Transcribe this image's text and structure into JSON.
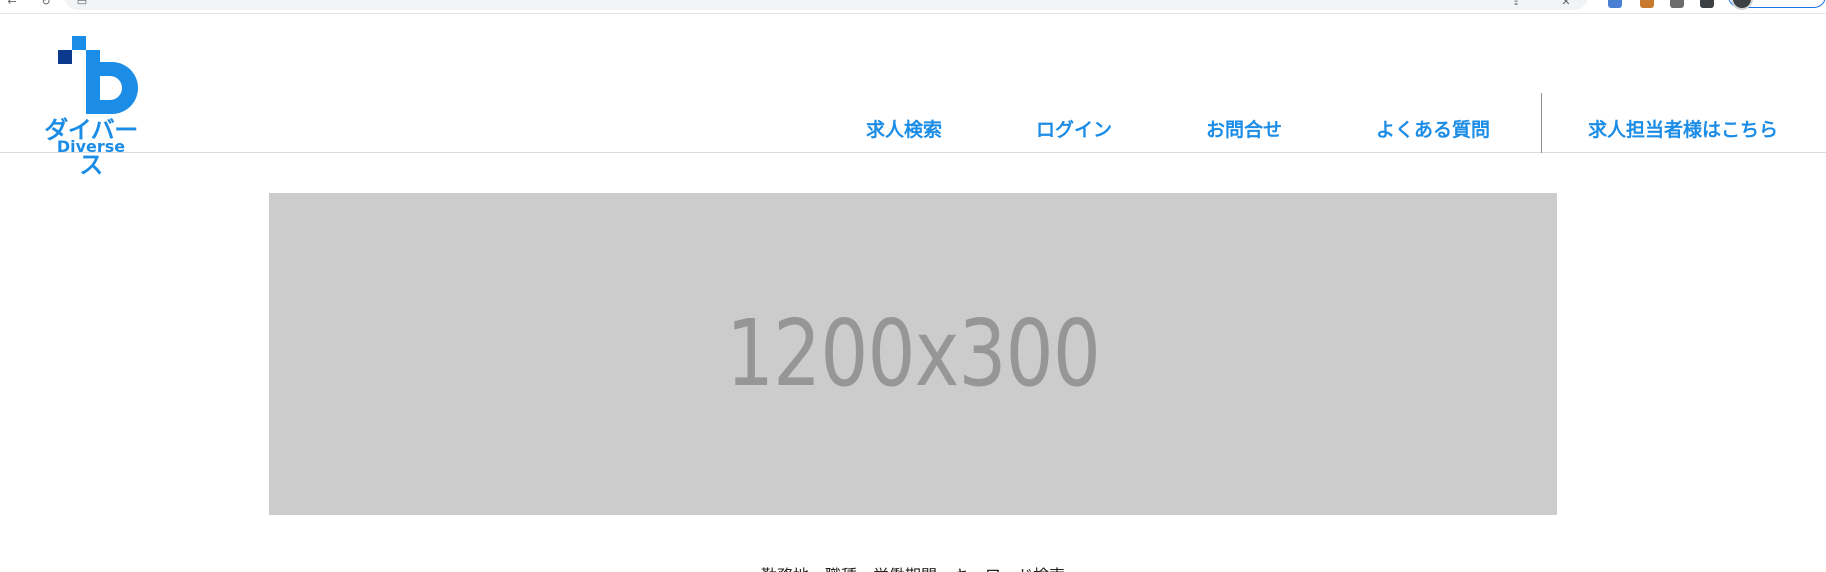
{
  "browser": {
    "icons": [
      "back-icon",
      "reload-icon",
      "site-info-icon",
      "share-icon",
      "bookmark-star-icon",
      "extension-icon",
      "profile-avatar-icon"
    ]
  },
  "header": {
    "logo": {
      "name_jp": "ダイバース",
      "name_en": "Diverse",
      "brand_color": "#1c8de6",
      "dark_color": "#0b3a8c"
    },
    "nav": [
      {
        "label": "求人検索"
      },
      {
        "label": "ログイン"
      },
      {
        "label": "お問合せ"
      },
      {
        "label": "よくある質問"
      },
      {
        "label": "求人担当者様はこちら"
      }
    ]
  },
  "banner": {
    "placeholder_text": "1200x300"
  },
  "search": {
    "criteria_label": "勤務地　職種　労働期間　キーワード検索"
  },
  "colors": {
    "accent": "#1c8de6",
    "banner_bg": "#cccccc",
    "banner_text": "#969696"
  }
}
